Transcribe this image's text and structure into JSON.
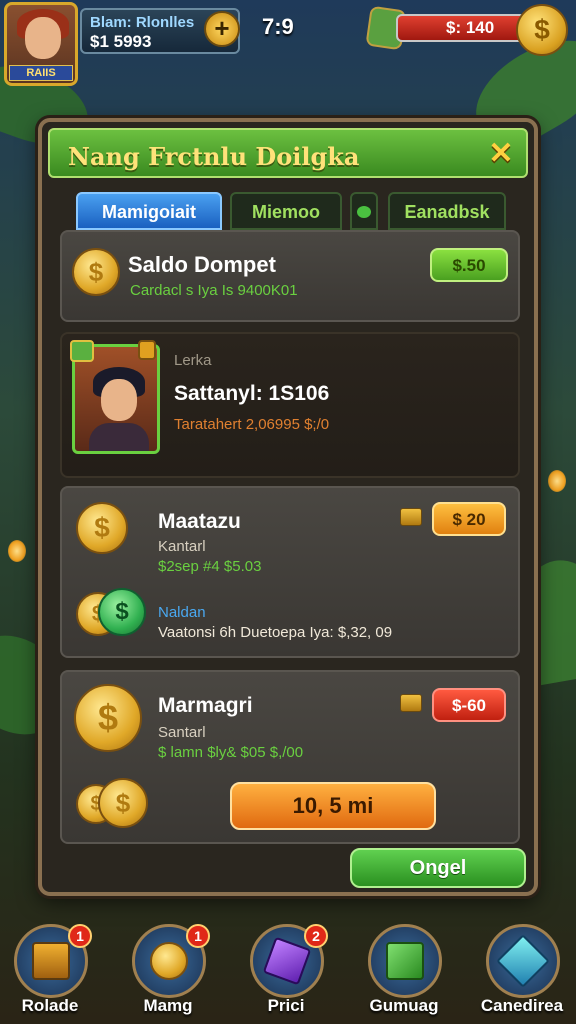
{
  "hud": {
    "avatar_name": "RAIIS",
    "panel_line1": "Blam: Rlonlles",
    "panel_line2": "$1 5993",
    "plus_label": "+",
    "timer": "7:9",
    "currency_value": "$: 140",
    "currency_symbol": "$"
  },
  "dialog": {
    "title": "Nang Frctnlu Doilgka",
    "close_label": "✕",
    "tabs": [
      {
        "label": "Mamigoiait",
        "active": true
      },
      {
        "label": "Miemoo",
        "active": false
      },
      {
        "label": "",
        "active": false
      },
      {
        "label": "Eanadbsk",
        "active": false
      }
    ],
    "balance": {
      "title": "Saldo Dompet",
      "subtitle": "Cardacl s Iya Is 9400K01",
      "price": "$.50"
    },
    "character": {
      "label": "Lerka",
      "title": "Sattanyl: 1S106",
      "detail": "Taratahert 2,06995 $;/0"
    },
    "offer1": {
      "title": "Maatazu",
      "subtitle": "Kantarl",
      "green_line": "$2sep #4 $5.03",
      "blue_label": "Naldan",
      "detail": "Vaatonsi 6h Duetoepa Iya: $,32, 09",
      "price": "$ 20"
    },
    "offer2": {
      "title": "Marmagri",
      "subtitle": "Santarl",
      "green_line": "$ lamn $ly& $05 $,/00",
      "price": "$-60",
      "buy_label": "10, 5 mi"
    },
    "confirm_label": "Ongel"
  },
  "nav": [
    {
      "label": "Rolade",
      "badge": "1",
      "icon": "chest-icon"
    },
    {
      "label": "Mamg",
      "badge": "1",
      "icon": "coins-icon"
    },
    {
      "label": "Prici",
      "badge": "2",
      "icon": "gem-icon"
    },
    {
      "label": "Gumuag",
      "badge": "",
      "icon": "cube-icon"
    },
    {
      "label": "Canedirea",
      "badge": "",
      "icon": "crystal-icon"
    }
  ],
  "colors": {
    "accent_green": "#6ad040",
    "accent_gold": "#e0a828",
    "tab_active": "#1a60c0",
    "price_red": "#c02010"
  }
}
